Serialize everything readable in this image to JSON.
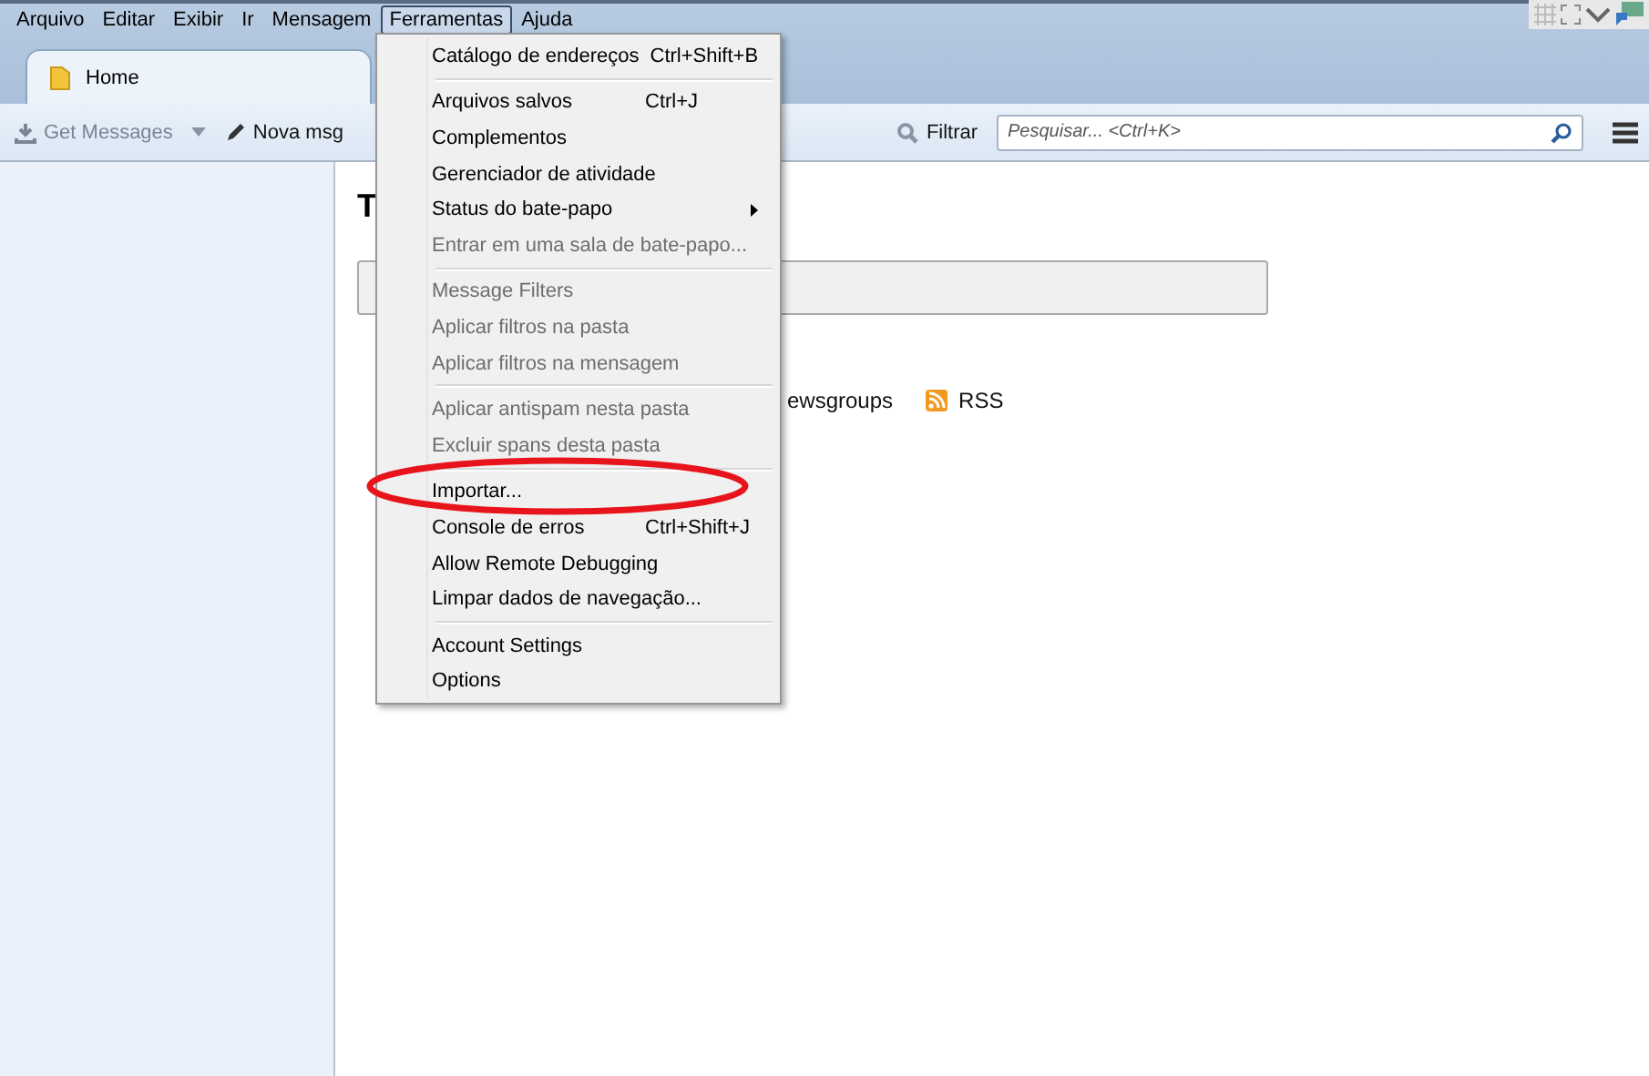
{
  "menubar": [
    {
      "label": "Arquivo",
      "selected": false
    },
    {
      "label": "Editar",
      "selected": false
    },
    {
      "label": "Exibir",
      "selected": false
    },
    {
      "label": "Ir",
      "selected": false
    },
    {
      "label": "Mensagem",
      "selected": false
    },
    {
      "label": "Ferramentas",
      "selected": true
    },
    {
      "label": "Ajuda",
      "selected": false
    }
  ],
  "tabs": [
    {
      "label": "Home",
      "selected": true
    }
  ],
  "toolbar": {
    "get_messages": {
      "label": "Get Messages",
      "disabled": true
    },
    "write": {
      "label": "Nova msg"
    },
    "filter": {
      "label": "Filtrar"
    },
    "search": {
      "placeholder": "Pesquisar... <Ctrl+K>"
    }
  },
  "content": {
    "heading": "T",
    "links": [
      {
        "label": "ewsgroups",
        "kind": "text"
      },
      {
        "label": "RSS",
        "kind": "rss"
      }
    ]
  },
  "menu": [
    {
      "kind": "item",
      "label": "Catálogo de endereços",
      "shortcut": "Ctrl+Shift+B",
      "disabled": false
    },
    {
      "kind": "separator"
    },
    {
      "kind": "item",
      "label": "Arquivos salvos",
      "shortcut": "Ctrl+J",
      "disabled": false
    },
    {
      "kind": "item",
      "label": "Complementos",
      "disabled": false
    },
    {
      "kind": "item",
      "label": "Gerenciador de atividade",
      "disabled": false
    },
    {
      "kind": "item",
      "label": "Status do bate-papo",
      "disabled": false,
      "submenu": true
    },
    {
      "kind": "item",
      "label": "Entrar em uma sala de bate-papo...",
      "disabled": true
    },
    {
      "kind": "separator"
    },
    {
      "kind": "item",
      "label": "Message Filters",
      "disabled": true
    },
    {
      "kind": "item",
      "label": "Aplicar filtros na pasta",
      "disabled": true
    },
    {
      "kind": "item",
      "label": "Aplicar filtros na mensagem",
      "disabled": true
    },
    {
      "kind": "separator"
    },
    {
      "kind": "item",
      "label": "Aplicar antispam nesta pasta",
      "disabled": true
    },
    {
      "kind": "item",
      "label": "Excluir spans desta pasta",
      "disabled": true
    },
    {
      "kind": "separator"
    },
    {
      "kind": "item",
      "label": "Importar...",
      "disabled": false
    },
    {
      "kind": "item",
      "label": "Console de erros",
      "shortcut": "Ctrl+Shift+J",
      "disabled": false
    },
    {
      "kind": "item",
      "label": "Allow Remote Debugging",
      "disabled": false
    },
    {
      "kind": "item",
      "label": "Limpar dados de navegação...",
      "disabled": false
    },
    {
      "kind": "separator"
    },
    {
      "kind": "item",
      "label": "Account Settings",
      "disabled": false
    },
    {
      "kind": "item",
      "label": "Options",
      "disabled": false
    }
  ]
}
